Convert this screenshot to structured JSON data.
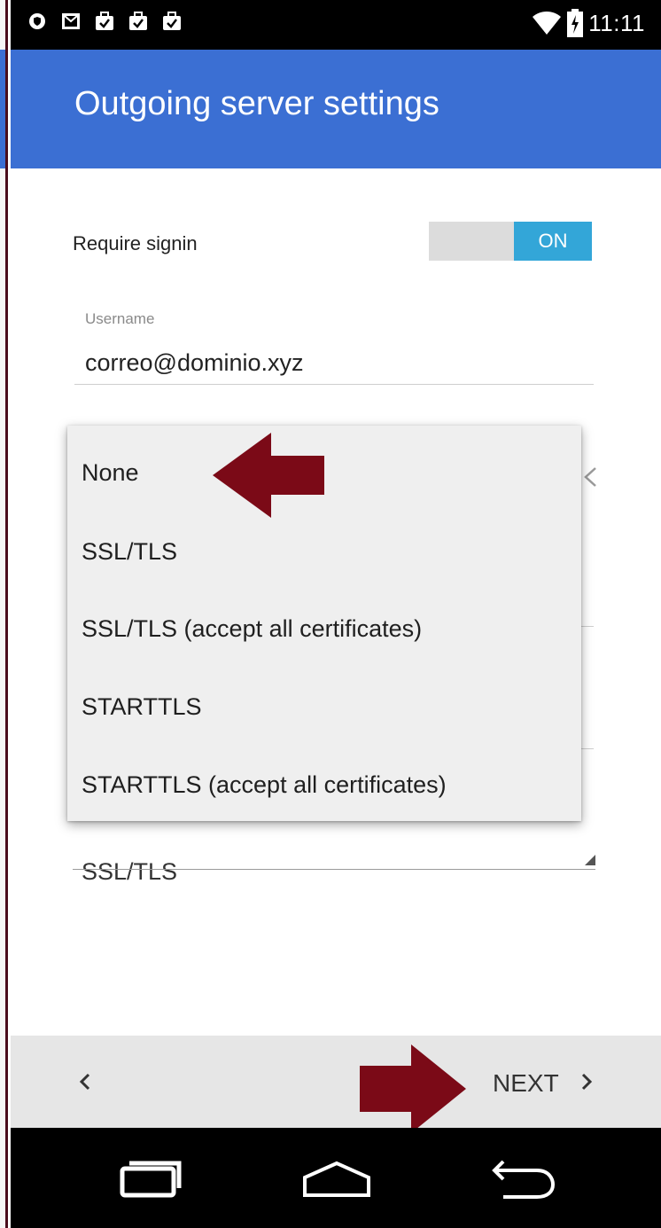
{
  "status_bar": {
    "time": "11:11",
    "icons": [
      "shield-icon",
      "gmail-icon",
      "work-briefcase-icon",
      "work-briefcase-icon",
      "work-briefcase-icon",
      "wifi-icon",
      "battery-icon"
    ]
  },
  "app_bar": {
    "title": "Outgoing server settings"
  },
  "require_signin": {
    "label": "Require signin",
    "toggle_label": "ON",
    "checked": true
  },
  "username": {
    "label": "Username",
    "value": "correo@dominio.xyz"
  },
  "security_dropdown": {
    "options": [
      "None",
      "SSL/TLS",
      "SSL/TLS (accept all certificates)",
      "STARTTLS",
      "STARTTLS (accept all certificates)"
    ],
    "highlighted_option": "None"
  },
  "security_select": {
    "value": "SSL/TLS"
  },
  "bottom_bar": {
    "next_label": "NEXT"
  },
  "annotations": {
    "arrow_color": "#7b0a17"
  },
  "colors": {
    "app_bar": "#3b6fd3",
    "toggle_on": "#33a6d8"
  }
}
